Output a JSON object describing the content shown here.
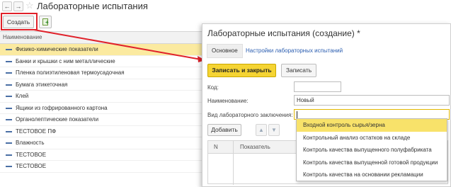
{
  "window": {
    "title": "Лабораторные испытания",
    "back_glyph": "←",
    "forward_glyph": "→",
    "star_glyph": "☆"
  },
  "toolbar": {
    "create_label": "Создать",
    "copy_icon": "copy-plus-icon"
  },
  "list": {
    "column_header": "Наименование",
    "rows": [
      "Физико-химические показатели",
      "Банки и крышки с ним металлические",
      "Пленка полиэтиленовая термоусадочная",
      "Бумага этикеточная",
      "Клей",
      "Ящики из гофрированного картона",
      "Органолептические показатели",
      "ТЕСТОВОЕ ПФ",
      "Влажность",
      "ТЕСТОВОЕ",
      "ТЕСТОВОЕ"
    ],
    "selected_index": 0
  },
  "form": {
    "title": "Лабораторные испытания (создание) *",
    "tabs": {
      "main": "Основное",
      "settings_link": "Настройки лабораторных испытаний"
    },
    "buttons": {
      "save_close": "Записать и закрыть",
      "save": "Записать",
      "add": "Добавить",
      "up_glyph": "▲",
      "down_glyph": "▼"
    },
    "fields": {
      "code_label": "Код:",
      "code_value": "",
      "name_label": "Наименование:",
      "name_value": "Новый",
      "kind_label": "Вид лабораторного заключения:",
      "kind_value": ""
    },
    "table": {
      "col_n": "N",
      "col_indicator": "Показатель"
    }
  },
  "dropdown": {
    "items": [
      "Входной контроль сырья/зерна",
      "Контрольный анализ остатков на складе",
      "Контроль качества выпущенного полуфабриката",
      "Контроль качества выпущенной готовой продукции",
      "Контроль качества на основании рекламации"
    ],
    "active_index": 0
  },
  "colors": {
    "highlight_red": "#e0212a",
    "accent_yellow": "#f5d433",
    "selected_row": "#fbeaa0",
    "link_blue": "#2a5db0"
  }
}
